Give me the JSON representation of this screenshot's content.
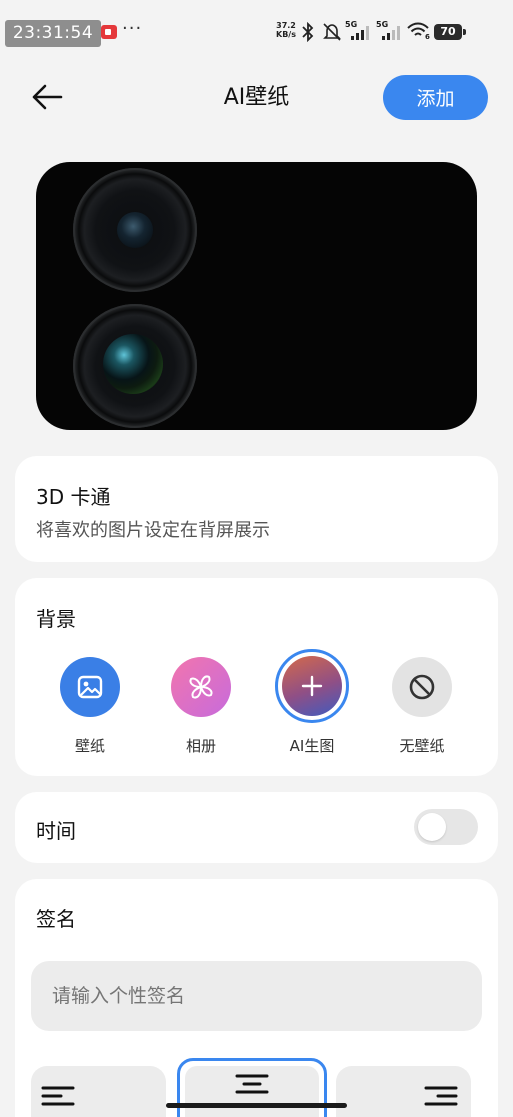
{
  "status_bar": {
    "time": "23:31:54",
    "more": "···",
    "net_speed_value": "37.2",
    "net_speed_unit": "KB/s",
    "signal1_label": "5G",
    "signal2_label": "5G",
    "wifi_label": "6",
    "battery": "70"
  },
  "header": {
    "title": "AI壁纸",
    "add_label": "添加"
  },
  "style": {
    "title": "3D 卡通",
    "description": "将喜欢的图片设定在背屏展示"
  },
  "background": {
    "title": "背景",
    "options": [
      {
        "label": "壁纸",
        "icon": "image-icon"
      },
      {
        "label": "相册",
        "icon": "pinwheel-icon"
      },
      {
        "label": "AI生图",
        "icon": "plus-icon",
        "selected": true
      },
      {
        "label": "无壁纸",
        "icon": "prohibited-icon"
      }
    ]
  },
  "time_setting": {
    "title": "时间",
    "enabled": false
  },
  "signature": {
    "title": "签名",
    "placeholder": "请输入个性签名",
    "alignment_options": [
      "align-left-icon",
      "align-center-icon",
      "align-right-icon"
    ],
    "selected_alignment": "center"
  },
  "colors": {
    "accent": "#3a87ef",
    "background": "#f3f3f3",
    "card": "#ffffff"
  }
}
